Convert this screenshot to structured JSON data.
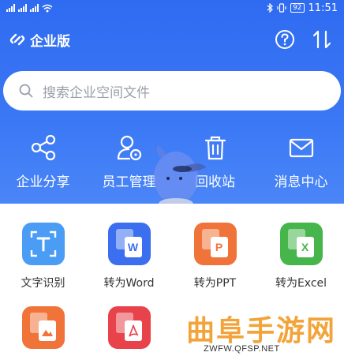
{
  "status_bar": {
    "battery": "92",
    "time": "11:51"
  },
  "header": {
    "brand": "企业版"
  },
  "search": {
    "placeholder": "搜索企业空间文件"
  },
  "quick_actions": [
    {
      "label": "企业分享",
      "icon": "share-icon"
    },
    {
      "label": "员工管理",
      "icon": "user-manage-icon"
    },
    {
      "label": "回收站",
      "icon": "trash-icon"
    },
    {
      "label": "消息中心",
      "icon": "mail-icon"
    }
  ],
  "tools": [
    {
      "label": "文字识别",
      "icon": "ocr-icon",
      "color": "#4a9cf5",
      "letter": "T"
    },
    {
      "label": "转为Word",
      "icon": "word-icon",
      "color": "#3b6ff0",
      "letter": "W"
    },
    {
      "label": "转为PPT",
      "icon": "ppt-icon",
      "color": "#f0743a",
      "letter": "P"
    },
    {
      "label": "转为Excel",
      "icon": "excel-icon",
      "color": "#46b54c",
      "letter": "X"
    }
  ],
  "tools_row2": [
    {
      "icon": "image-icon",
      "color": "#f0743a"
    },
    {
      "icon": "pdf-icon",
      "color": "#e8434a"
    }
  ],
  "watermark": {
    "title": "曲阜手游网",
    "url": "ZWFW.QFSP.NET"
  },
  "colors": {
    "hero": "#3b78f5",
    "panel": "#ffffff"
  }
}
